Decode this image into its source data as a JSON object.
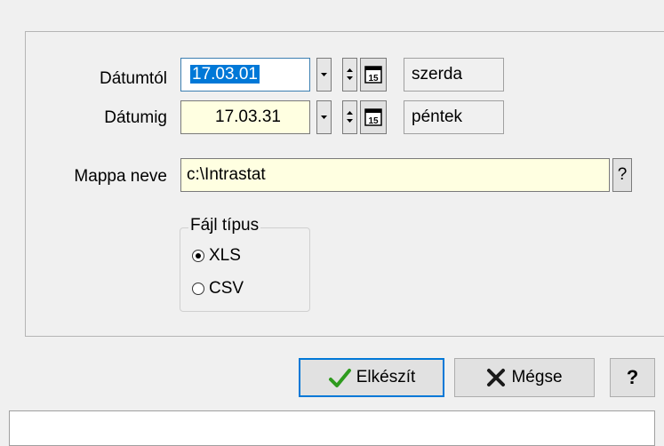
{
  "form": {
    "from_label": "Dátumtól",
    "to_label": "Dátumig",
    "from_date": "17.03.01",
    "to_date": "17.03.31",
    "from_day": "szerda",
    "to_day": "péntek",
    "calendar_icon_text": "15",
    "folder_label": "Mappa neve",
    "folder_value": "c:\\Intrastat",
    "folder_help": "?"
  },
  "file_type": {
    "title": "Fájl típus",
    "options": [
      "XLS",
      "CSV"
    ],
    "selected": "XLS"
  },
  "buttons": {
    "create": "Elkészít",
    "cancel": "Mégse",
    "help": "?"
  },
  "colors": {
    "field_bg": "#ffffe1",
    "selection": "#0078d7",
    "check": "#2e9b1e",
    "cross": "#1a1a1a"
  }
}
